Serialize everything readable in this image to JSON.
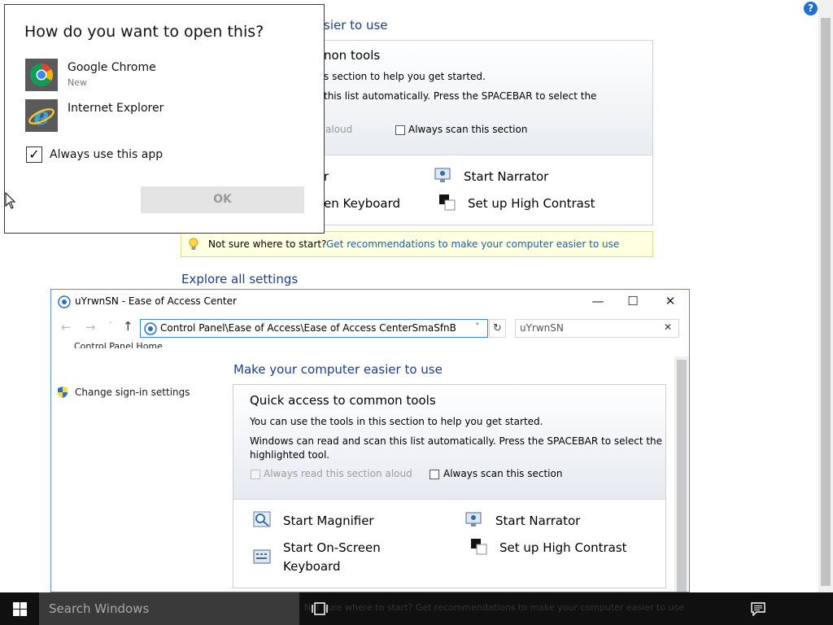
{
  "background_page": {
    "heading_partial": "sier to use",
    "quick_access_partial": "non tools",
    "line1_partial": "s section to help you get started.",
    "line2_partial": "this list automatically.  Press the SPACEBAR to select the",
    "read_aloud_partial": "aloud",
    "always_scan": "Always scan this section",
    "narrator": "Start Narrator",
    "magnifier_partial": "r",
    "keyboard_partial": "en Keyboard",
    "high_contrast": "Set up High Contrast",
    "hint_text": "Not sure where to start?",
    "hint_link": "Get recommendations to make your computer easier to use",
    "explore": "Explore all settings"
  },
  "dialog": {
    "title": "How do you want to open this?",
    "apps": [
      {
        "name": "Google Chrome",
        "sub": "New",
        "icon": "chrome-icon"
      },
      {
        "name": "Internet Explorer",
        "sub": "",
        "icon": "internet-explorer-icon"
      }
    ],
    "always_use": "Always use this app",
    "always_use_checked": true,
    "ok": "OK"
  },
  "window": {
    "title": "uYrwnSN - Ease of Access Center",
    "address": "Control Panel\\Ease of Access\\Ease of Access CenterSmaSfnB",
    "search_value": "uYrwnSN",
    "sidebar": {
      "home_partial": "Control Panel Home",
      "signin": "Change sign-in settings"
    },
    "main": {
      "heading": "Make your computer easier to use",
      "quick_title": "Quick access to common tools",
      "line1": "You can use the tools in this section to help you get started.",
      "line2a": "Windows can read and scan this list automatically.  Press the SPACEBAR to select the",
      "line2b": "highlighted tool.",
      "read_aloud": "Always read this section aloud",
      "scan": "Always scan this section",
      "magnifier": "Start Magnifier",
      "narrator": "Start Narrator",
      "keyboard_1": "Start On-Screen",
      "keyboard_2": "Keyboard",
      "high_contrast": "Set up High Contrast"
    }
  },
  "taskbar": {
    "search_placeholder": "Search Windows",
    "hidden_hint": "Not sure where to start? Get recommendations to make your computer easier to use"
  }
}
